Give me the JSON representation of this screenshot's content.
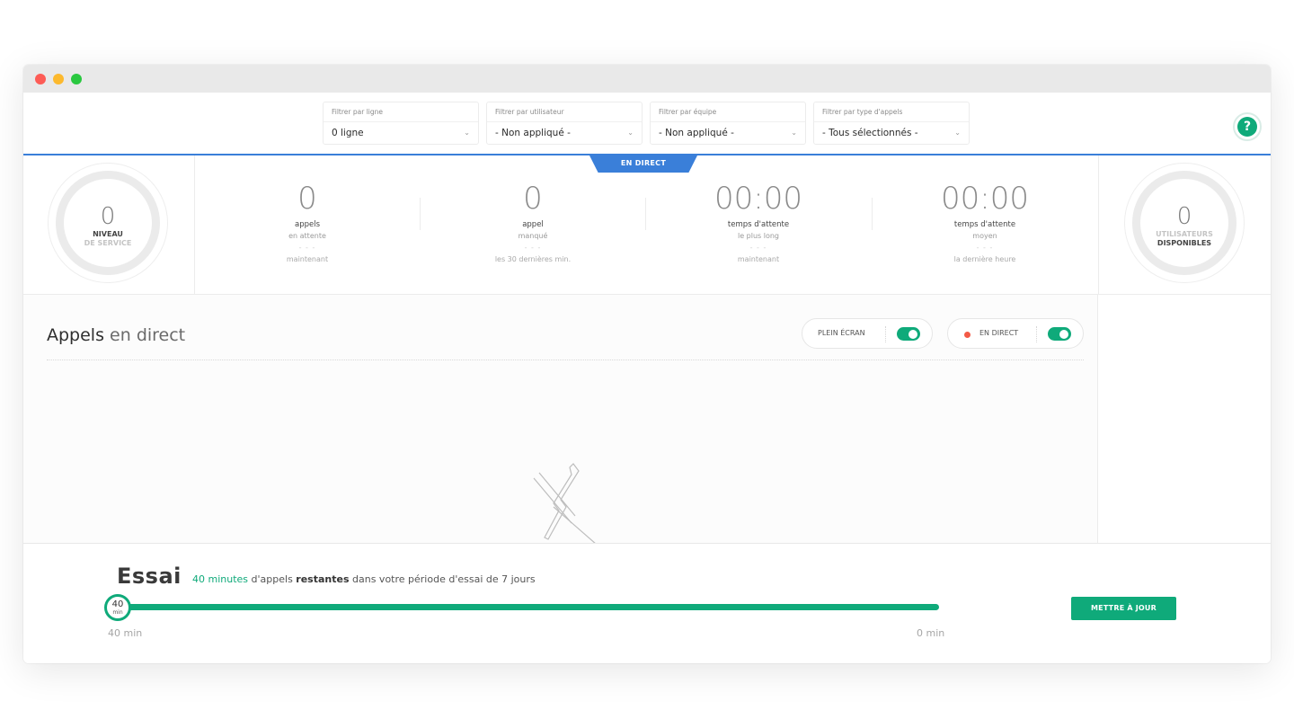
{
  "filters": [
    {
      "label": "Filtrer par ligne",
      "value": "0 ligne"
    },
    {
      "label": "Filtrer par utilisateur",
      "value": "- Non appliqué -"
    },
    {
      "label": "Filtrer par équipe",
      "value": "- Non appliqué -"
    },
    {
      "label": "Filtrer par type d'appels",
      "value": "- Tous sélectionnés -"
    }
  ],
  "help_label": "?",
  "live_tab": "EN DIRECT",
  "service_level": {
    "value": "0",
    "line1": "NIVEAU",
    "line2": "DE SERVICE"
  },
  "stats": [
    {
      "value": "0",
      "label": "appels",
      "sub": "en attente",
      "dots": "- - -",
      "period": "maintenant"
    },
    {
      "value": "0",
      "label": "appel",
      "sub": "manqué",
      "dots": "- - -",
      "period": "les 30 dernières min."
    },
    {
      "value": "00:00",
      "label": "temps d'attente",
      "sub": "le plus long",
      "dots": "- - -",
      "period": "maintenant"
    },
    {
      "value": "00:00",
      "label": "temps d'attente",
      "sub": "moyen",
      "dots": "- - -",
      "period": "la dernière heure"
    }
  ],
  "available_users": {
    "value": "0",
    "line1": "UTILISATEURS",
    "line2": "DISPONIBLES"
  },
  "main": {
    "title_bold": "Appels",
    "title_light": "en direct",
    "fullscreen_label": "PLEIN ÉCRAN",
    "fullscreen_on": true,
    "live_label": "EN DIRECT",
    "live_on": true
  },
  "trial": {
    "title": "Essai",
    "minutes_text": "40 minutes",
    "msg_part1": " d'appels ",
    "msg_bold": "restantes",
    "msg_part2": " dans votre période d'essai de 7 jours",
    "knob_value": "40",
    "knob_unit": "min",
    "start_label": "40 min",
    "end_label": "0 min",
    "remaining_fraction": 1.0,
    "update_button": "METTRE À JOUR"
  },
  "colors": {
    "accent": "#0faa7a",
    "live_blue": "#3a7fd9",
    "live_dot": "#f35a46"
  }
}
